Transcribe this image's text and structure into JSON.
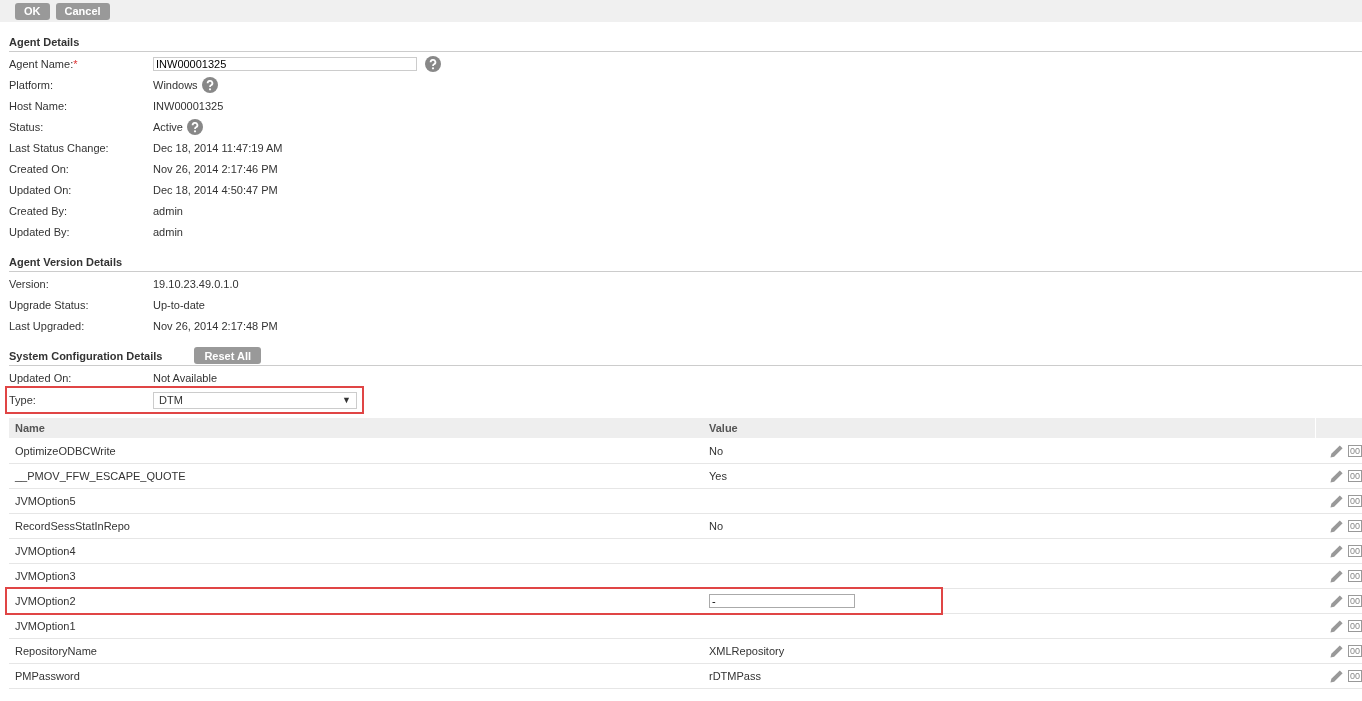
{
  "toolbar": {
    "buttons": [
      "OK",
      "Cancel"
    ]
  },
  "agent_details": {
    "title": "Agent Details",
    "fields": [
      {
        "label": "Agent Name:",
        "required_mark": "*",
        "kind": "input",
        "value": "INW00001325",
        "help": true
      },
      {
        "label": "Platform:",
        "kind": "text",
        "value": "Windows",
        "help": true
      },
      {
        "label": "Host Name:",
        "kind": "text",
        "value": "INW00001325"
      },
      {
        "label": "Status:",
        "kind": "text",
        "value": "Active",
        "help": true
      },
      {
        "label": "Last Status Change:",
        "kind": "text",
        "value": "Dec 18, 2014 11:47:19 AM"
      },
      {
        "label": "Created On:",
        "kind": "text",
        "value": "Nov 26, 2014 2:17:46 PM"
      },
      {
        "label": "Updated On:",
        "kind": "text",
        "value": "Dec 18, 2014 4:50:47 PM"
      },
      {
        "label": "Created By:",
        "kind": "text",
        "value": "admin"
      },
      {
        "label": "Updated By:",
        "kind": "text",
        "value": "admin"
      }
    ]
  },
  "agent_version_details": {
    "title": "Agent Version Details",
    "fields": [
      {
        "label": "Version:",
        "kind": "text",
        "value": "19.10.23.49.0.1.0"
      },
      {
        "label": "Upgrade Status:",
        "kind": "text",
        "value": "Up-to-date"
      },
      {
        "label": "Last Upgraded:",
        "kind": "text",
        "value": "Nov 26, 2014 2:17:48 PM"
      }
    ]
  },
  "system_configuration_details": {
    "title": "System Configuration Details",
    "reset_button": "Reset All",
    "fields": [
      {
        "label": "Updated On:",
        "kind": "text",
        "value": "Not Available"
      },
      {
        "label": "Type:",
        "kind": "select",
        "value": "DTM",
        "caret": "▼",
        "highlighted": true
      }
    ],
    "table": {
      "columns": [
        "Name",
        "Value"
      ],
      "rows": [
        {
          "name": "OptimizeODBCWrite",
          "value": "No",
          "kind": "text",
          "icon_text": "00"
        },
        {
          "name": "__PMOV_FFW_ESCAPE_QUOTE",
          "value": "Yes",
          "kind": "text",
          "icon_text": "00"
        },
        {
          "name": "JVMOption5",
          "kind": "text",
          "icon_text": "00"
        },
        {
          "name": "RecordSessStatInRepo",
          "value": "No",
          "kind": "text",
          "icon_text": "00"
        },
        {
          "name": "JVMOption4",
          "kind": "text",
          "icon_text": "00"
        },
        {
          "name": "JVMOption3",
          "kind": "text",
          "icon_text": "00"
        },
        {
          "name": "JVMOption2",
          "value": "-",
          "kind": "input",
          "highlighted": true,
          "icon_text": "00"
        },
        {
          "name": "JVMOption1",
          "kind": "text",
          "icon_text": "00"
        },
        {
          "name": "RepositoryName",
          "value": "XMLRepository",
          "kind": "text",
          "icon_text": "00"
        },
        {
          "name": "PMPassword",
          "value": "rDTMPass",
          "kind": "text",
          "icon_text": "00"
        }
      ]
    }
  }
}
